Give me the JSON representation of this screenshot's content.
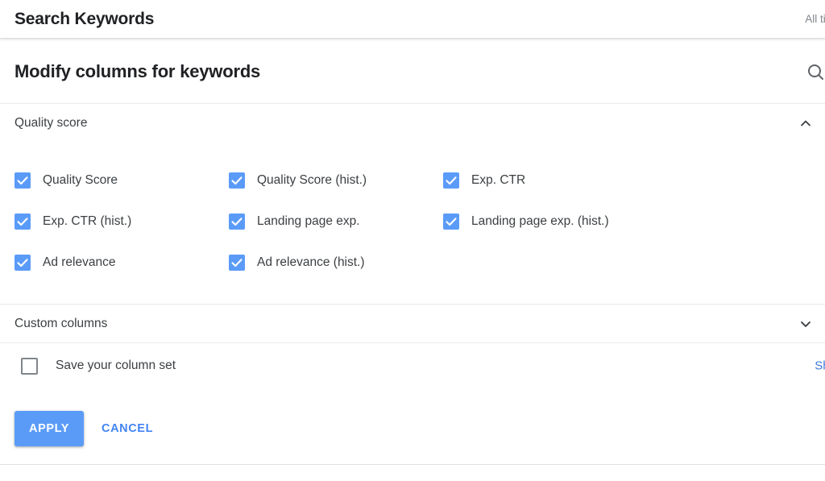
{
  "header": {
    "title": "Search Keywords",
    "date_range": "All tim",
    "date_range_full": "All time"
  },
  "dialog": {
    "title": "Modify columns for keywords",
    "search_icon": "search-icon"
  },
  "sections": [
    {
      "id": "quality-score",
      "label": "Quality score",
      "expanded": true,
      "chevron": "chevron-up-icon",
      "columns": [
        [
          {
            "label": "Quality Score",
            "checked": true
          },
          {
            "label": "Exp. CTR (hist.)",
            "checked": true
          },
          {
            "label": "Ad relevance",
            "checked": true
          }
        ],
        [
          {
            "label": "Quality Score (hist.)",
            "checked": true
          },
          {
            "label": "Landing page exp.",
            "checked": true
          },
          {
            "label": "Ad relevance (hist.)",
            "checked": true
          }
        ],
        [
          {
            "label": "Exp. CTR",
            "checked": true
          },
          {
            "label": "Landing page exp. (hist.)",
            "checked": true
          }
        ]
      ]
    },
    {
      "id": "custom-columns",
      "label": "Custom columns",
      "expanded": false,
      "chevron": "chevron-down-icon"
    }
  ],
  "save_set": {
    "label": "Save your column set",
    "checked": false,
    "show_link": "Sho",
    "show_link_full": "Show"
  },
  "footer": {
    "apply_label": "APPLY",
    "cancel_label": "CANCEL"
  },
  "colors": {
    "accent_blue": "#5b9bf8",
    "link_blue": "#4285f4",
    "text_primary": "#202124",
    "text_secondary": "#3c4043",
    "text_muted": "#80868b",
    "divider": "#e8eaed",
    "background": "#ffffff"
  }
}
